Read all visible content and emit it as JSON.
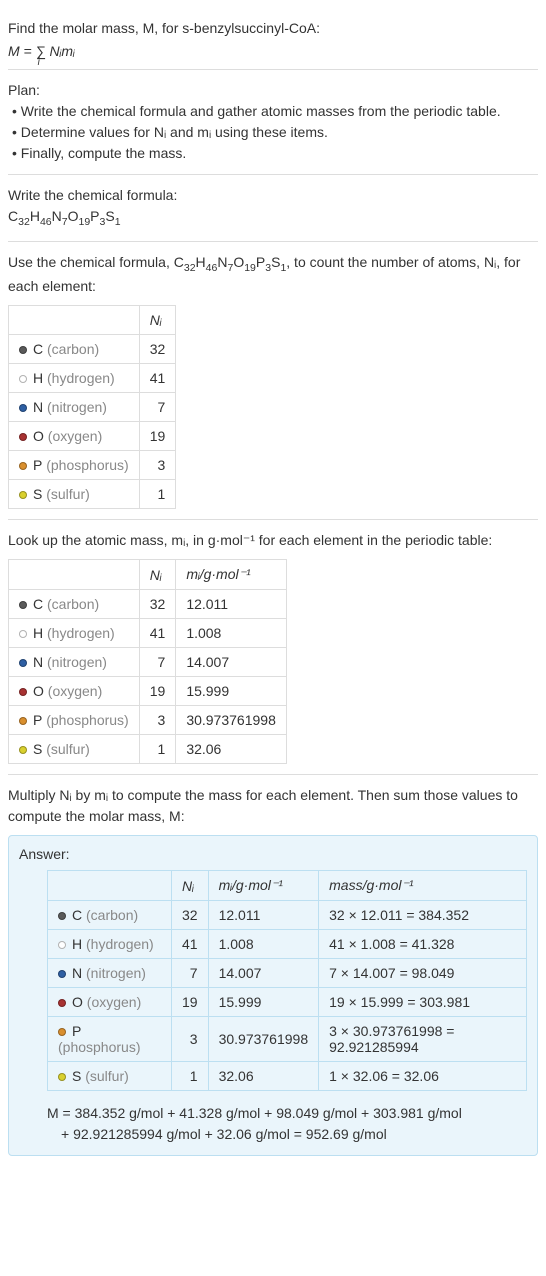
{
  "intro": {
    "line1": "Find the molar mass, M, for s-benzylsuccinyl-CoA:",
    "formula_prefix": "M = ",
    "formula_sigma": "∑",
    "formula_sub": "i",
    "formula_rest": " Nᵢmᵢ"
  },
  "plan": {
    "title": "Plan:",
    "items": [
      "• Write the chemical formula and gather atomic masses from the periodic table.",
      "• Determine values for Nᵢ and mᵢ using these items.",
      "• Finally, compute the mass."
    ]
  },
  "chemformula": {
    "title": "Write the chemical formula:",
    "parts": [
      "C",
      "32",
      "H",
      "46",
      "N",
      "7",
      "O",
      "19",
      "P",
      "3",
      "S",
      "1"
    ]
  },
  "count_section": {
    "intro_a": "Use the chemical formula, ",
    "intro_b": ", to count the number of atoms, Nᵢ, for each element:",
    "headers": [
      "",
      "Nᵢ"
    ],
    "rows": [
      {
        "color": "#5a5a5a",
        "sym": "C",
        "name": "(carbon)",
        "n": "32"
      },
      {
        "color": "#ffffff",
        "sym": "H",
        "name": "(hydrogen)",
        "n": "41"
      },
      {
        "color": "#2e5fa3",
        "sym": "N",
        "name": "(nitrogen)",
        "n": "7"
      },
      {
        "color": "#a83232",
        "sym": "O",
        "name": "(oxygen)",
        "n": "19"
      },
      {
        "color": "#d98f2e",
        "sym": "P",
        "name": "(phosphorus)",
        "n": "3"
      },
      {
        "color": "#d9d02e",
        "sym": "S",
        "name": "(sulfur)",
        "n": "1"
      }
    ]
  },
  "mass_section": {
    "intro": "Look up the atomic mass, mᵢ, in g·mol⁻¹ for each element in the periodic table:",
    "headers": [
      "",
      "Nᵢ",
      "mᵢ/g·mol⁻¹"
    ],
    "rows": [
      {
        "color": "#5a5a5a",
        "sym": "C",
        "name": "(carbon)",
        "n": "32",
        "m": "12.011"
      },
      {
        "color": "#ffffff",
        "sym": "H",
        "name": "(hydrogen)",
        "n": "41",
        "m": "1.008"
      },
      {
        "color": "#2e5fa3",
        "sym": "N",
        "name": "(nitrogen)",
        "n": "7",
        "m": "14.007"
      },
      {
        "color": "#a83232",
        "sym": "O",
        "name": "(oxygen)",
        "n": "19",
        "m": "15.999"
      },
      {
        "color": "#d98f2e",
        "sym": "P",
        "name": "(phosphorus)",
        "n": "3",
        "m": "30.973761998"
      },
      {
        "color": "#d9d02e",
        "sym": "S",
        "name": "(sulfur)",
        "n": "1",
        "m": "32.06"
      }
    ]
  },
  "multiply_intro": "Multiply Nᵢ by mᵢ to compute the mass for each element. Then sum those values to compute the molar mass, M:",
  "answer": {
    "title": "Answer:",
    "headers": [
      "",
      "Nᵢ",
      "mᵢ/g·mol⁻¹",
      "mass/g·mol⁻¹"
    ],
    "rows": [
      {
        "color": "#5a5a5a",
        "sym": "C",
        "name": "(carbon)",
        "n": "32",
        "m": "12.011",
        "mass": "32 × 12.011 = 384.352"
      },
      {
        "color": "#ffffff",
        "sym": "H",
        "name": "(hydrogen)",
        "n": "41",
        "m": "1.008",
        "mass": "41 × 1.008 = 41.328"
      },
      {
        "color": "#2e5fa3",
        "sym": "N",
        "name": "(nitrogen)",
        "n": "7",
        "m": "14.007",
        "mass": "7 × 14.007 = 98.049"
      },
      {
        "color": "#a83232",
        "sym": "O",
        "name": "(oxygen)",
        "n": "19",
        "m": "15.999",
        "mass": "19 × 15.999 = 303.981"
      },
      {
        "color": "#d98f2e",
        "sym": "P",
        "name": "(phosphorus)",
        "n": "3",
        "m": "30.973761998",
        "mass": "3 × 30.973761998 = 92.921285994"
      },
      {
        "color": "#d9d02e",
        "sym": "S",
        "name": "(sulfur)",
        "n": "1",
        "m": "32.06",
        "mass": "1 × 32.06 = 32.06"
      }
    ],
    "final1": "M = 384.352 g/mol + 41.328 g/mol + 98.049 g/mol + 303.981 g/mol",
    "final2": "+ 92.921285994 g/mol + 32.06 g/mol = 952.69 g/mol"
  }
}
